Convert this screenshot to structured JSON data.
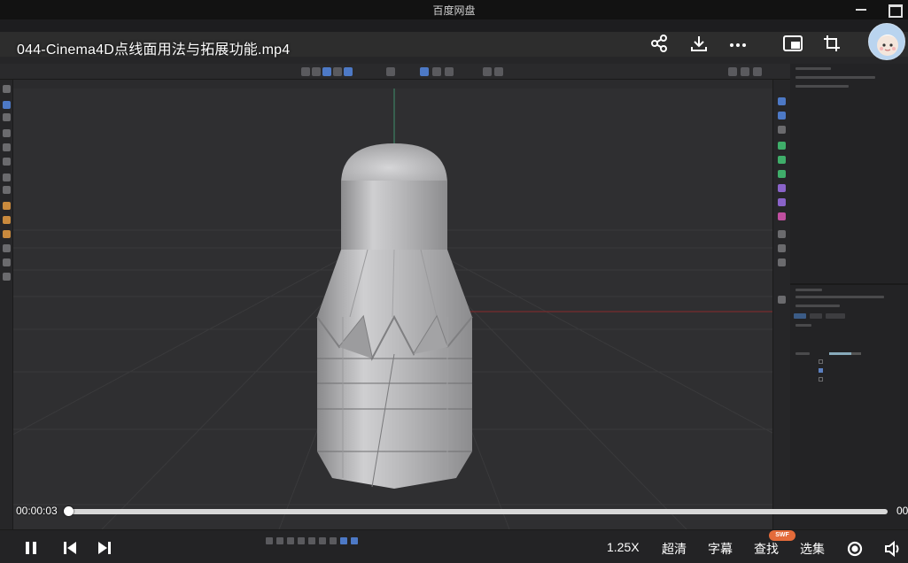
{
  "window": {
    "title": "百度网盘",
    "minimize_icon": "minimize-icon",
    "maximize_icon": "maximize-icon"
  },
  "player": {
    "video_title": "044-Cinema4D点线面用法与拓展功能.mp4",
    "current_time": "00:00:03",
    "end_time_visible": "00",
    "progress_fraction": 0.002,
    "speed_label": "1.25X",
    "quality_label": "超清",
    "subtitle_label": "字幕",
    "search_label": "查找",
    "playlist_label": "选集",
    "badge": "SWF",
    "top_icons": [
      "share-icon",
      "download-icon",
      "more-icon",
      "picture-in-picture-icon",
      "fullscreen-crop-icon"
    ],
    "bottom_icons": [
      "pause-icon",
      "previous-icon",
      "next-icon",
      "settings-icon",
      "volume-icon"
    ]
  },
  "colors": {
    "accent_progress": "#d8d8d8",
    "c4d_bg": "#2f2f31",
    "selection_blue": "#4d79c6"
  }
}
